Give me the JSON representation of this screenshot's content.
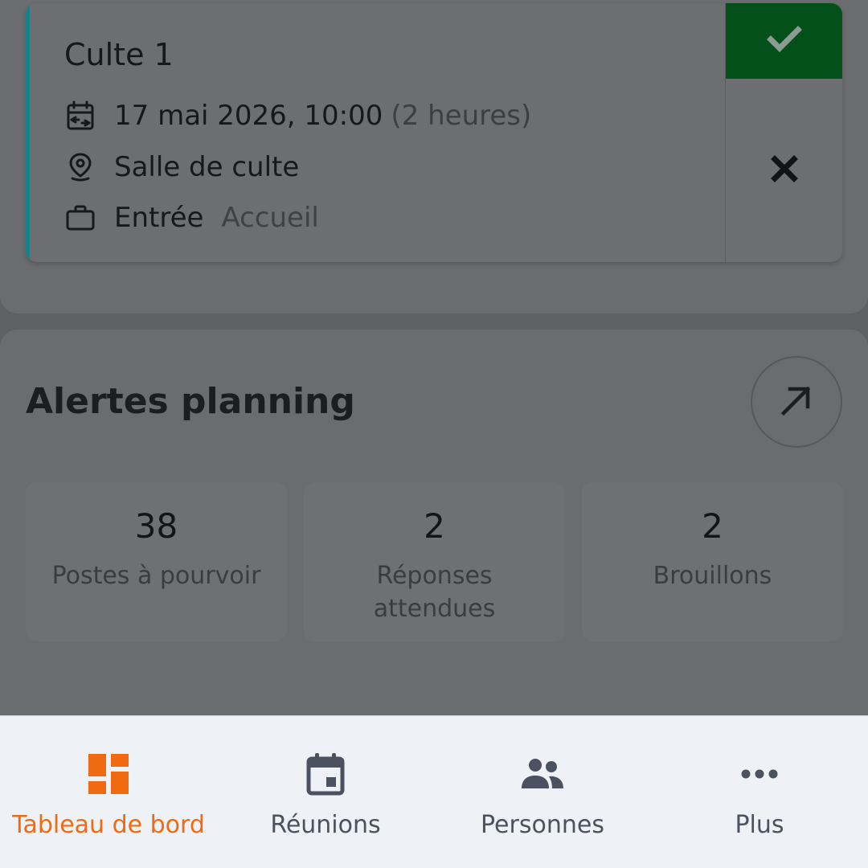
{
  "event": {
    "title": "Culte 1",
    "date": "17 mai 2026, 10:00",
    "duration": "(2 heures)",
    "place": "Salle de culte",
    "role": "Entrée",
    "team": "Accueil",
    "accent_color": "#17808a",
    "accept_color": "#03501b",
    "icons": {
      "date": "calendar-icon",
      "place": "location-pin-icon",
      "role": "briefcase-icon",
      "accept": "check-icon",
      "decline": "close-icon"
    }
  },
  "alerts": {
    "title": "Alertes planning",
    "link_icon": "arrow-up-right-icon",
    "stats": [
      {
        "value": "38",
        "label": "Postes à pourvoir"
      },
      {
        "value": "2",
        "label": "Réponses attendues"
      },
      {
        "value": "2",
        "label": "Brouillons"
      }
    ]
  },
  "nav": {
    "active_color": "#f06a11",
    "items": [
      {
        "label": "Tableau de bord",
        "icon": "dashboard-icon",
        "active": true
      },
      {
        "label": "Réunions",
        "icon": "calendar-icon",
        "active": false
      },
      {
        "label": "Personnes",
        "icon": "people-icon",
        "active": false
      },
      {
        "label": "Plus",
        "icon": "more-icon",
        "active": false
      }
    ]
  }
}
